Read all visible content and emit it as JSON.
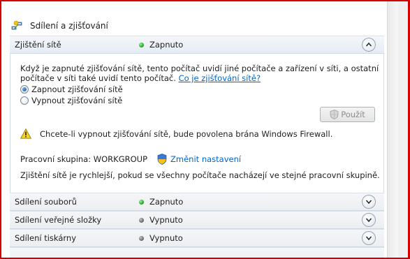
{
  "header": {
    "title": "Sdílení a zjišťování",
    "icon": "network-icon"
  },
  "sections": [
    {
      "label": "Zjištění sítě",
      "status": "Zapnuto",
      "status_color": "green",
      "expanded": true
    },
    {
      "label": "Sdílení souborů",
      "status": "Zapnuto",
      "status_color": "green",
      "expanded": false
    },
    {
      "label": "Sdílení veřejné složky",
      "status": "Vypnuto",
      "status_color": "gray",
      "expanded": false
    },
    {
      "label": "Sdílení tiskárny",
      "status": "Vypnuto",
      "status_color": "gray",
      "expanded": false
    }
  ],
  "discovery": {
    "description_line1": "Když je zapnuté zjišťování sítě, tento počítač uvidí jiné počítače a zařízení v síti, a ostatní",
    "description_line2": "počítače v síti také uvidí tento počítač.",
    "help_link": "Co je zjišťování sítě?",
    "option_on": "Zapnout zjišťování sítě",
    "option_off": "Vypnout zjišťování sítě",
    "selected": "on",
    "apply_button": "Použít",
    "warning": "Chcete-li vypnout zjišťování sítě, bude povolena brána Windows Firewall.",
    "workgroup_label": "Pracovní skupina: WORKGROUP",
    "change_settings_link": "Změnit nastavení",
    "footer_text": "Zjištění sítě je rychlejší, pokud se všechny počítače nacházejí ve stejné pracovní skupině."
  },
  "colors": {
    "frame": "#d40000",
    "link": "#0066cc",
    "status_on": "#1fae1f",
    "status_off": "#6f6f6f"
  }
}
